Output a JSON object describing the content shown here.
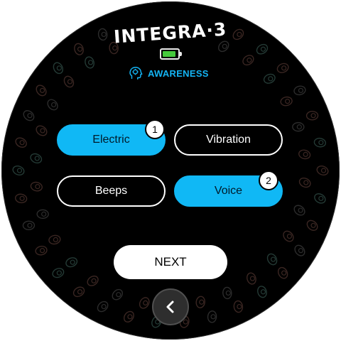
{
  "header": {
    "title": "INTEGRA·3",
    "battery_level": 1.0,
    "battery_color": "#45c93c",
    "mode_icon": "head-brain-icon",
    "mode_label": "AWARENESS",
    "accent_color": "#14b4f4"
  },
  "options": [
    {
      "label": "Electric",
      "selected": true,
      "order": "1"
    },
    {
      "label": "Vibration",
      "selected": false,
      "order": ""
    },
    {
      "label": "Beeps",
      "selected": false,
      "order": ""
    },
    {
      "label": "Voice",
      "selected": true,
      "order": "2"
    }
  ],
  "actions": {
    "next_label": "NEXT",
    "back_icon": "chevron-left-icon"
  }
}
